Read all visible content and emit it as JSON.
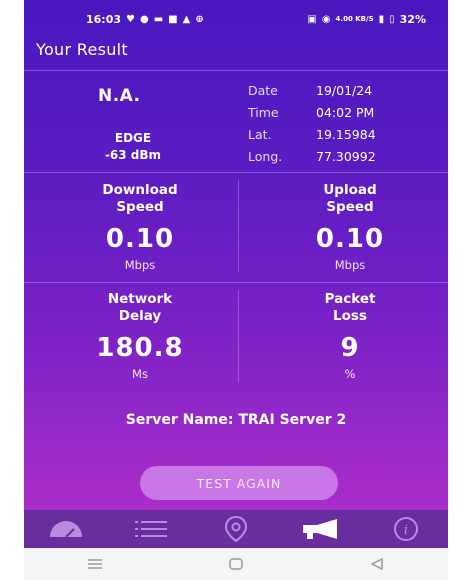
{
  "status_bar": {
    "time": "16:03",
    "network_speed": "4.00 KB/S",
    "battery": "32%"
  },
  "header": {
    "title": "Your Result"
  },
  "summary": {
    "operator": "N.A.",
    "network_type": "EDGE",
    "signal": "-63 dBm",
    "date_label": "Date",
    "date_value": "19/01/24",
    "time_label": "Time",
    "time_value": "04:02 PM",
    "lat_label": "Lat.",
    "lat_value": "19.15984",
    "long_label": "Long.",
    "long_value": "77.30992"
  },
  "metrics": {
    "download": {
      "title_l1": "Download",
      "title_l2": "Speed",
      "value": "0.10",
      "unit": "Mbps"
    },
    "upload": {
      "title_l1": "Upload",
      "title_l2": "Speed",
      "value": "0.10",
      "unit": "Mbps"
    },
    "delay": {
      "title_l1": "Network",
      "title_l2": "Delay",
      "value": "180.8",
      "unit": "Ms"
    },
    "loss": {
      "title_l1": "Packet",
      "title_l2": "Loss",
      "value": "9",
      "unit": "%"
    }
  },
  "server": {
    "text": "Server Name: TRAI Server 2"
  },
  "actions": {
    "test_again": "TEST AGAIN"
  },
  "bottom_nav": [
    "speedometer-icon",
    "list-icon",
    "location-pin-icon",
    "megaphone-icon",
    "info-icon"
  ],
  "colors": {
    "accent": "#c977e6",
    "background_top": "#4a18bf",
    "background_bottom": "#b22fc9"
  }
}
